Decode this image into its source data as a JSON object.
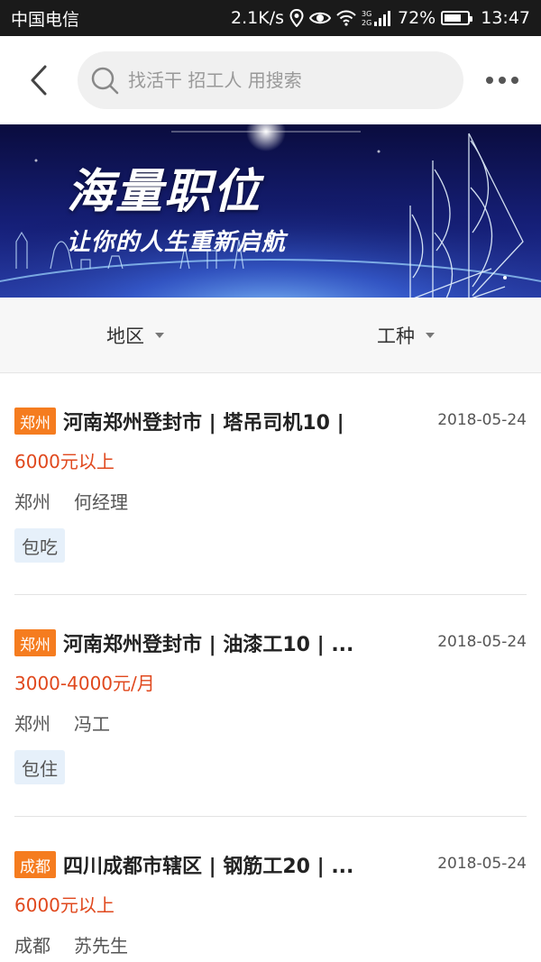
{
  "status_bar": {
    "carrier": "中国电信",
    "net_speed": "2.1K/s",
    "network_type": "3G 2G",
    "battery": "72%",
    "battery_level": 0.72,
    "time": "13:47"
  },
  "nav": {
    "search_placeholder": "找活干 招工人 用搜索",
    "back_icon": "chevron-left-icon",
    "more_icon": "more-dots-icon"
  },
  "banner": {
    "title": "海量职位",
    "subtitle": "让你的人生重新启航"
  },
  "filters": [
    {
      "label": "地区"
    },
    {
      "label": "工种"
    }
  ],
  "jobs": [
    {
      "city_tag": "郑州",
      "title": "河南郑州登封市 | 塔吊司机10 |",
      "date": "2018-05-24",
      "salary": "6000元以上",
      "location": "郑州",
      "contact": "何经理",
      "benefit": "包吃"
    },
    {
      "city_tag": "郑州",
      "title": "河南郑州登封市 | 油漆工10 | ...",
      "date": "2018-05-24",
      "salary": "3000-4000元/月",
      "location": "郑州",
      "contact": "冯工",
      "benefit": "包住"
    },
    {
      "city_tag": "成都",
      "title": "四川成都市辖区 | 钢筋工20 | ...",
      "date": "2018-05-24",
      "salary": "6000元以上",
      "location": "成都",
      "contact": "苏先生"
    }
  ],
  "colors": {
    "city_tag_bg": "#f57c1f",
    "salary": "#e0481d",
    "benefit_bg": "#e6f0fa",
    "banner_bg": "#14186a"
  }
}
